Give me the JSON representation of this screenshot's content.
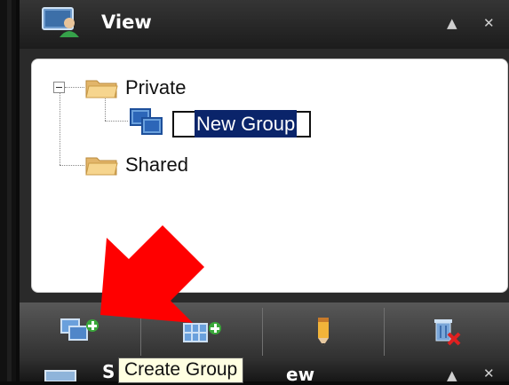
{
  "view_panel": {
    "title": "View",
    "icon": "monitor-group-icon",
    "collapse_glyph": "▲",
    "close_glyph": "✕"
  },
  "tree": {
    "nodes": [
      {
        "label": "Private",
        "icon": "folder-icon",
        "expanded": true
      },
      {
        "label": "New Group",
        "icon": "group-icon",
        "editing": true
      },
      {
        "label": "Shared",
        "icon": "folder-icon"
      }
    ]
  },
  "toolbar": {
    "buttons": [
      {
        "name": "create-group-button",
        "icon": "create-group-icon"
      },
      {
        "name": "create-layout-button",
        "icon": "create-layout-icon"
      },
      {
        "name": "rename-button",
        "icon": "pencil-icon"
      },
      {
        "name": "delete-button",
        "icon": "delete-icon"
      }
    ]
  },
  "tooltip": {
    "text": "Create Group"
  },
  "next_panel": {
    "title_start": "S",
    "title_end": "ew",
    "collapse_glyph": "▲",
    "close_glyph": "✕"
  },
  "colors": {
    "annotation_arrow": "#ff0000",
    "selection": "#0a246a",
    "tooltip_bg": "#ffffe1"
  }
}
